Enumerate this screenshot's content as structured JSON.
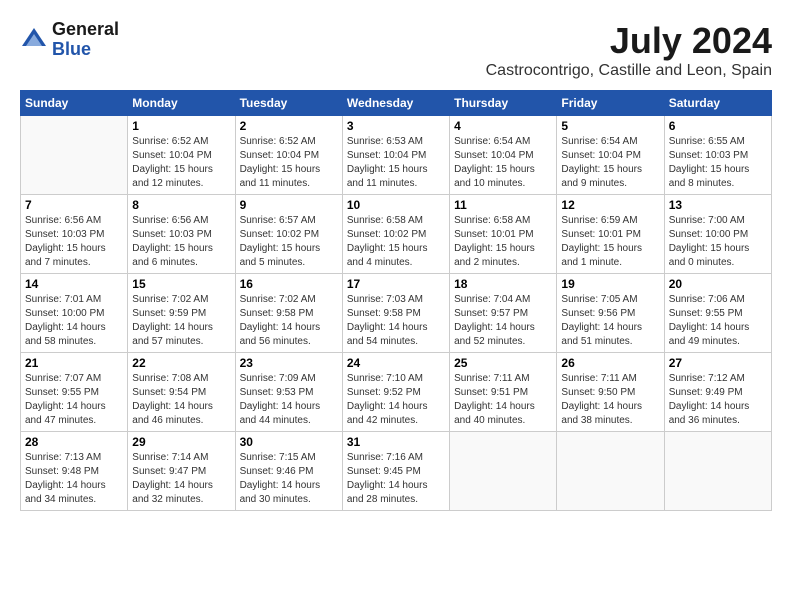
{
  "header": {
    "logo_general": "General",
    "logo_blue": "Blue",
    "month_title": "July 2024",
    "location": "Castrocontrigo, Castille and Leon, Spain"
  },
  "days_of_week": [
    "Sunday",
    "Monday",
    "Tuesday",
    "Wednesday",
    "Thursday",
    "Friday",
    "Saturday"
  ],
  "weeks": [
    [
      {
        "day": "",
        "info": ""
      },
      {
        "day": "1",
        "info": "Sunrise: 6:52 AM\nSunset: 10:04 PM\nDaylight: 15 hours\nand 12 minutes."
      },
      {
        "day": "2",
        "info": "Sunrise: 6:52 AM\nSunset: 10:04 PM\nDaylight: 15 hours\nand 11 minutes."
      },
      {
        "day": "3",
        "info": "Sunrise: 6:53 AM\nSunset: 10:04 PM\nDaylight: 15 hours\nand 11 minutes."
      },
      {
        "day": "4",
        "info": "Sunrise: 6:54 AM\nSunset: 10:04 PM\nDaylight: 15 hours\nand 10 minutes."
      },
      {
        "day": "5",
        "info": "Sunrise: 6:54 AM\nSunset: 10:04 PM\nDaylight: 15 hours\nand 9 minutes."
      },
      {
        "day": "6",
        "info": "Sunrise: 6:55 AM\nSunset: 10:03 PM\nDaylight: 15 hours\nand 8 minutes."
      }
    ],
    [
      {
        "day": "7",
        "info": "Sunrise: 6:56 AM\nSunset: 10:03 PM\nDaylight: 15 hours\nand 7 minutes."
      },
      {
        "day": "8",
        "info": "Sunrise: 6:56 AM\nSunset: 10:03 PM\nDaylight: 15 hours\nand 6 minutes."
      },
      {
        "day": "9",
        "info": "Sunrise: 6:57 AM\nSunset: 10:02 PM\nDaylight: 15 hours\nand 5 minutes."
      },
      {
        "day": "10",
        "info": "Sunrise: 6:58 AM\nSunset: 10:02 PM\nDaylight: 15 hours\nand 4 minutes."
      },
      {
        "day": "11",
        "info": "Sunrise: 6:58 AM\nSunset: 10:01 PM\nDaylight: 15 hours\nand 2 minutes."
      },
      {
        "day": "12",
        "info": "Sunrise: 6:59 AM\nSunset: 10:01 PM\nDaylight: 15 hours\nand 1 minute."
      },
      {
        "day": "13",
        "info": "Sunrise: 7:00 AM\nSunset: 10:00 PM\nDaylight: 15 hours\nand 0 minutes."
      }
    ],
    [
      {
        "day": "14",
        "info": "Sunrise: 7:01 AM\nSunset: 10:00 PM\nDaylight: 14 hours\nand 58 minutes."
      },
      {
        "day": "15",
        "info": "Sunrise: 7:02 AM\nSunset: 9:59 PM\nDaylight: 14 hours\nand 57 minutes."
      },
      {
        "day": "16",
        "info": "Sunrise: 7:02 AM\nSunset: 9:58 PM\nDaylight: 14 hours\nand 56 minutes."
      },
      {
        "day": "17",
        "info": "Sunrise: 7:03 AM\nSunset: 9:58 PM\nDaylight: 14 hours\nand 54 minutes."
      },
      {
        "day": "18",
        "info": "Sunrise: 7:04 AM\nSunset: 9:57 PM\nDaylight: 14 hours\nand 52 minutes."
      },
      {
        "day": "19",
        "info": "Sunrise: 7:05 AM\nSunset: 9:56 PM\nDaylight: 14 hours\nand 51 minutes."
      },
      {
        "day": "20",
        "info": "Sunrise: 7:06 AM\nSunset: 9:55 PM\nDaylight: 14 hours\nand 49 minutes."
      }
    ],
    [
      {
        "day": "21",
        "info": "Sunrise: 7:07 AM\nSunset: 9:55 PM\nDaylight: 14 hours\nand 47 minutes."
      },
      {
        "day": "22",
        "info": "Sunrise: 7:08 AM\nSunset: 9:54 PM\nDaylight: 14 hours\nand 46 minutes."
      },
      {
        "day": "23",
        "info": "Sunrise: 7:09 AM\nSunset: 9:53 PM\nDaylight: 14 hours\nand 44 minutes."
      },
      {
        "day": "24",
        "info": "Sunrise: 7:10 AM\nSunset: 9:52 PM\nDaylight: 14 hours\nand 42 minutes."
      },
      {
        "day": "25",
        "info": "Sunrise: 7:11 AM\nSunset: 9:51 PM\nDaylight: 14 hours\nand 40 minutes."
      },
      {
        "day": "26",
        "info": "Sunrise: 7:11 AM\nSunset: 9:50 PM\nDaylight: 14 hours\nand 38 minutes."
      },
      {
        "day": "27",
        "info": "Sunrise: 7:12 AM\nSunset: 9:49 PM\nDaylight: 14 hours\nand 36 minutes."
      }
    ],
    [
      {
        "day": "28",
        "info": "Sunrise: 7:13 AM\nSunset: 9:48 PM\nDaylight: 14 hours\nand 34 minutes."
      },
      {
        "day": "29",
        "info": "Sunrise: 7:14 AM\nSunset: 9:47 PM\nDaylight: 14 hours\nand 32 minutes."
      },
      {
        "day": "30",
        "info": "Sunrise: 7:15 AM\nSunset: 9:46 PM\nDaylight: 14 hours\nand 30 minutes."
      },
      {
        "day": "31",
        "info": "Sunrise: 7:16 AM\nSunset: 9:45 PM\nDaylight: 14 hours\nand 28 minutes."
      },
      {
        "day": "",
        "info": ""
      },
      {
        "day": "",
        "info": ""
      },
      {
        "day": "",
        "info": ""
      }
    ]
  ]
}
